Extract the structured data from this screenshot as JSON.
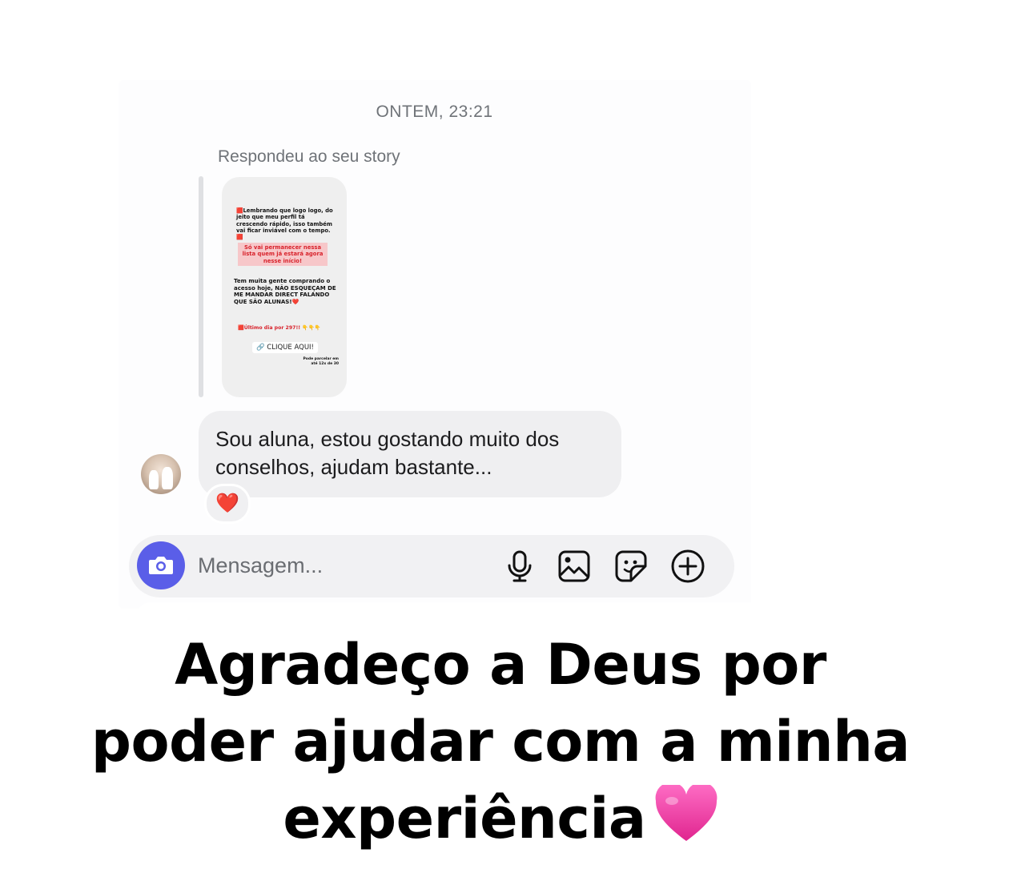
{
  "conversation": {
    "timestamp": "ONTEM, 23:21",
    "reply_label": "Respondeu ao seu story",
    "story": {
      "line1": "🟥Lembrando que logo logo, do jeito que meu perfil tá crescendo rápido, isso também vai ficar inviável com o tempo.🟥",
      "line2": "Só vai permanecer nessa lista quem já estará agora nesse início!",
      "line3": "Tem muita gente comprando o acesso hoje, NÃO ESQUEÇAM DE ME MANDAR DIRECT FALANDO QUE SÃO ALUNAS!❤️",
      "line4": "🟥Último dia por 297!! 👇👇👇",
      "link_icon": "🔗",
      "cta": "CLIQUE AQUI!",
      "footnote": "Pode parcelar em até 12x de 30"
    },
    "message_text": "Sou aluna, estou gostando muito dos conselhos, ajudam bastante...",
    "reaction": "❤️"
  },
  "composer": {
    "placeholder": "Mensagem...",
    "icons": [
      "camera-icon",
      "microphone-icon",
      "gallery-icon",
      "sticker-icon",
      "plus-icon"
    ],
    "accent": "#5a5ee8"
  },
  "caption": {
    "line1": "Agradeço a Deus por",
    "line2": "poder ajudar com a minha",
    "line3": "experiência",
    "heart_color": "#ec3ea8"
  }
}
